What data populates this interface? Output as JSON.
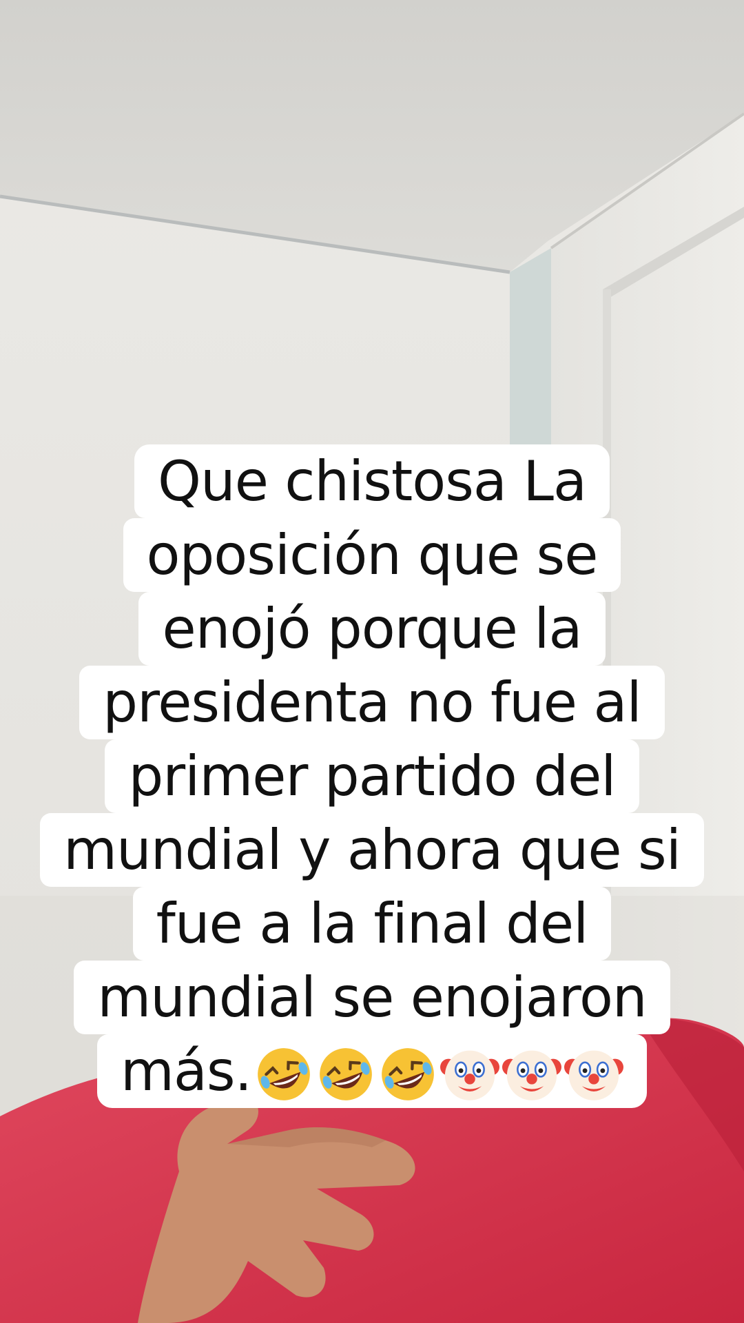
{
  "caption": {
    "lines": [
      "Que chistosa La",
      "oposición que se",
      "enojó porque la",
      "presidenta no fue al",
      "primer partido del",
      "mundial y ahora que si",
      "fue a la final del",
      "mundial se enojaron"
    ],
    "last_line_text": "más.",
    "emojis": [
      "rolling-laughing-emoji",
      "rolling-laughing-emoji",
      "rolling-laughing-emoji",
      "clown-face-emoji",
      "clown-face-emoji",
      "clown-face-emoji"
    ]
  },
  "colors": {
    "wall": "#e8e7e3",
    "ceiling": "#d9d8d4",
    "shirt": "#d8344e",
    "skin": "#c68c6c",
    "caption_bg": "#ffffff",
    "caption_text": "#111111"
  }
}
